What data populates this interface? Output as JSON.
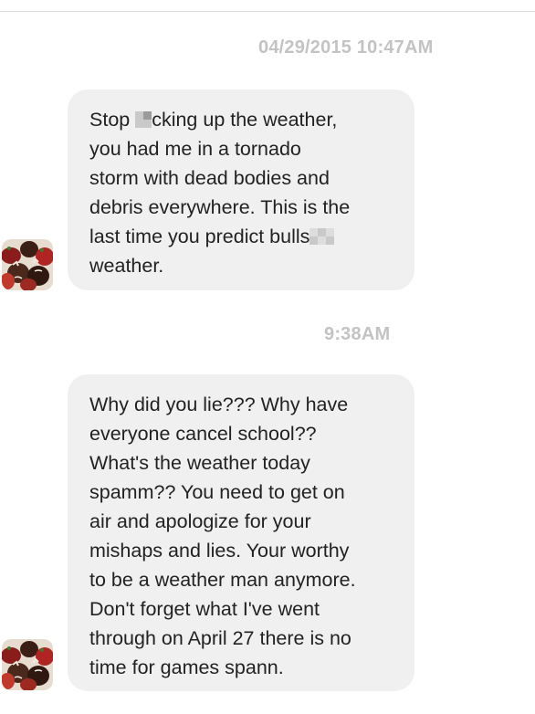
{
  "conversation": {
    "messages": [
      {
        "timestamp": "04/29/2015 10:47AM",
        "lines": [
          [
            "Stop ",
            "cking up the weather,"
          ],
          [
            "you had me in a tornado"
          ],
          [
            "storm with dead bodies and"
          ],
          [
            "debris everywhere. This is the"
          ],
          [
            "last time you predict bulls",
            ""
          ],
          [
            "weather."
          ]
        ]
      },
      {
        "timestamp": "9:38AM",
        "lines": [
          [
            "Why did you lie??? Why have"
          ],
          [
            "everyone cancel school??"
          ],
          [
            "What's the weather today"
          ],
          [
            "spamm?? You need to get on"
          ],
          [
            "air and apologize for your"
          ],
          [
            "mishaps and lies. Your worthy"
          ],
          [
            "to be a weather man anymore."
          ],
          [
            "Don't forget what I've went"
          ],
          [
            "through on April 27 there is no"
          ],
          [
            "time for games spann."
          ]
        ]
      }
    ]
  },
  "colors": {
    "bubble": "#f1f0f0",
    "timestamp": "#c3c3c3",
    "text": "#222222"
  },
  "icons": {
    "avatar": "chocolate-strawberries-avatar",
    "censor": "pixelated-censor-block"
  }
}
